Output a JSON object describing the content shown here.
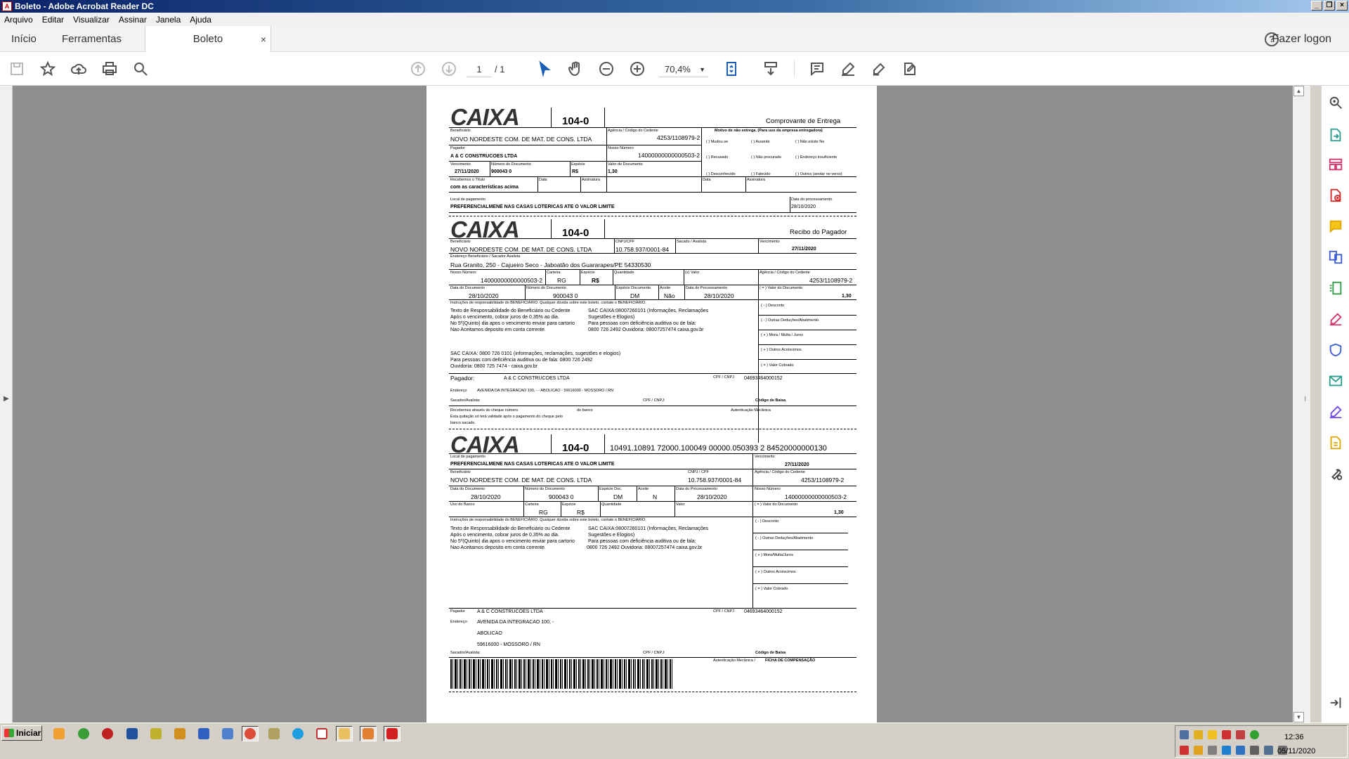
{
  "window": {
    "title": "Boleto - Adobe Acrobat Reader DC"
  },
  "menu": [
    "Arquivo",
    "Editar",
    "Visualizar",
    "Assinar",
    "Janela",
    "Ajuda"
  ],
  "tabs": {
    "home": "Início",
    "tools": "Ferramentas",
    "doc": "Boleto",
    "close": "×"
  },
  "header": {
    "help": "?",
    "login": "Fazer logon"
  },
  "toolbar": {
    "page_current": "1",
    "page_total": "/ 1",
    "zoom": "70,4%"
  },
  "taskbar": {
    "start": "Iniciar",
    "time": "12:36",
    "date": "05/11/2020"
  },
  "boleto": {
    "logo": "CAIXA",
    "bank_code": "104-0",
    "s1": {
      "title": "Comprovante de Entrega",
      "lbl_benef": "Beneficiário",
      "benef": "NOVO NORDESTE COM. DE MAT. DE CONS. LTDA",
      "lbl_agencia": "Agência / Código do Cedente",
      "agencia": "4253/1108979-2",
      "lbl_motivo": "Motivo de não entrega. (Para uso da empresa entregadora)",
      "m1": "(   ) Mudou-se",
      "m2": "(   ) Ausente",
      "m3": "(   ) Não existe No",
      "m4": "(   ) Recusado",
      "m5": "(   ) Não procurado",
      "m6": "(   ) Endereço insuficiente",
      "m7": "(   ) Desconhecido",
      "m8": "(   ) Falecido",
      "m9": "(   ) Outros (anotar no verso)",
      "lbl_pagador": "Pagador",
      "pagador": "A & C CONSTRUCOES LTDA",
      "lbl_nosso": "Nosso Número",
      "nosso": "14000000000000503-2",
      "lbl_venc": "Vencimento",
      "venc": "27/11/2020",
      "lbl_numdoc": "Número do Documento",
      "numdoc": "900043 0",
      "lbl_especie": "Espécie",
      "especie": "R$",
      "lbl_valor": "Valor do Documento",
      "valor": "1,30",
      "lbl_receb": "Recebemos o Título",
      "receb": "com as características acima",
      "lbl_data": "Data",
      "lbl_assin": "Assinatura",
      "lbl_local": "Local de pagamento",
      "local": "PREFERENCIALMENE NAS CASAS LOTERICAS ATE O VALOR LIMITE",
      "lbl_proc": "Data do processamento",
      "proc": "28/10/2020"
    },
    "s2": {
      "title": "Recibo do Pagador",
      "lbl_benef": "Beneficiário",
      "benef": "NOVO NORDESTE COM. DE MAT. DE CONS. LTDA",
      "lbl_cnpj": "CNPJ/CPF",
      "cnpj": "10.758.937/0001-84",
      "lbl_sacador": "Sacado / Avalista",
      "lbl_venc": "Vencimento",
      "venc": "27/11/2020",
      "lbl_end": "Endereço Beneficiário / Sacador Avalista",
      "end": "Rua Granito, 250  - Cajueiro Seco - Jaboatão dos Guararapes/PE 54330530",
      "lbl_nosso": "Nosso Número",
      "nosso": "14000000000000503-2",
      "lbl_carteira": "Carteira",
      "carteira": "RG",
      "lbl_especie": "Espécie",
      "especie": "R$",
      "lbl_qtd": "Quantidade",
      "lbl_xvalor": "(x) Valor",
      "lbl_agencia": "Agência / Código do Cedente",
      "agencia": "4253/1108979-2",
      "lbl_datadoc": "Data do Documento",
      "datadoc": "28/10/2020",
      "lbl_numdoc": "Número do Documento",
      "numdoc": "900043 0",
      "lbl_espdoc": "Espécie Documento",
      "espdoc": "DM",
      "lbl_aceite": "Aceite",
      "aceite": "Não",
      "lbl_dataproc": "Data do Processamento",
      "dataproc": "28/10/2020",
      "lbl_valordoc": "( = ) Valor do Documento",
      "valordoc": "1,30",
      "lbl_instr": "Instruções de responsabilidade do BENEFICIÁRIO. Qualquer dúvida sobre este boleto, contate o BENEFICIÁRIO.",
      "i1": "Texto de Responsabilidade do Beneficiário ou Cedente",
      "i2": "Após o vencimento, cobrar juros de 0,35% ao dia.",
      "i3": "No 5º(Quinto) dia apos o vencimento enviar para cartorio",
      "i4": "Nao Aceitamos deposito em conta corrente.",
      "j1": "SAC CAIXA:08007260101 (Informações, Reclamações",
      "j2": "Sugestões e Elogios)",
      "j3": "Para pessoas com deficiência auditiva ou de fala:",
      "j4": "0800 726 2492 Ouvidoria: 08007257474 caixa.gov.br",
      "k1": "SAC CAIXA: 0800 726 0101 (informações, reclamações, sugestões e elogios)",
      "k2": "Para pessoas com deficiência auditiva ou de fala: 0800 726 2492",
      "k3": "Ouvidoria: 0800 725 7474 - caixa.gov.br",
      "d1": "( - ) Desconto",
      "d2": "( - ) Outras Deduções/Abatimento",
      "d3": "( + ) Mora / Multa / Juros",
      "d4": "( + ) Outros Acréscimos",
      "d5": "( = ) Valor Cobrado",
      "lbl_pag": "Pagador:",
      "pag": "A & C CONSTRUCOES LTDA",
      "lbl_cpf": "CPF / CNPJ",
      "cpf": "04693464000152",
      "lbl_endereco": "Endereço",
      "endereco": "AVENIDA DA INTEGRACAO 100,  -  - ABOLICAO - 59616000 - MOSSORO / RN",
      "lbl_sac": "Sacador/Avalista:",
      "lbl_cpf2": "CPF / CNPJ:",
      "lbl_cod": "Código de Baixa",
      "r1": "Recebemos através do cheque número",
      "r2": "do banco",
      "r3": "Autenticação Mecânica",
      "r4": "Esta quitação só terá validade após o pagamento do cheque pelo",
      "r5": "banco sacado."
    },
    "s3": {
      "linha": "10491.10891 72000.100049 00000.050393 2 84520000000130",
      "lbl_local": "Local de pagamento",
      "local": "PREFERENCIALMENE NAS CASAS LOTERICAS ATE O VALOR LIMITE",
      "lbl_venc": "Vencimento",
      "venc": "27/11/2020",
      "lbl_benef": "Beneficiário",
      "benef": "NOVO NORDESTE COM. DE MAT. DE CONS. LTDA",
      "lbl_cnpj": "CNPJ / CPF",
      "cnpj": "10.758.937/0001-84",
      "lbl_agencia": "Agência / Código do Cedente",
      "agencia": "4253/1108979-2",
      "lbl_datadoc": "Data do Documento",
      "datadoc": "28/10/2020",
      "lbl_numdoc": "Número do Documento",
      "numdoc": "900043 0",
      "lbl_espdoc": "Espécie Doc.",
      "espdoc": "DM",
      "lbl_aceite": "Aceite",
      "aceite": "N",
      "lbl_dataproc": "Data do Processamento",
      "dataproc": "28/10/2020",
      "lbl_nosso": "Nosso Número",
      "nosso": "14000000000000503-2",
      "lbl_uso": "Uso do Banco",
      "lbl_carteira": "Carteira",
      "carteira": "RG",
      "lbl_especie": "Espécie",
      "especie": "R$",
      "lbl_qtd": "Quantidade",
      "lbl_valor": "Valor",
      "lbl_valordoc": "( = ) Valor do Documento",
      "valordoc": "1,30",
      "lbl_instr": "Instruções de responsabilidade do BENEFICIÁRIO. Qualquer dúvida sobre este boleto, contate o BENEFICIÁRIO.",
      "i1": "Texto de Responsabilidade do Beneficiário ou Cedente",
      "i2": "Após o vencimento, cobrar juros de 0,35% ao dia.",
      "i3": "No 5º(Quinto) dia apos o vencimento enviar para cartorio",
      "i4": "Nao Aceitamos deposito em conta corrente.",
      "j1": "SAC CAIXA:08007260101 (Informações, Reclamações",
      "j2": "Sugestões e Elogios)",
      "j3": "Para pessoas com deficiência auditiva ou de fala:",
      "j4": "0800 726 2492 Ouvidoria: 08007257474 caixa.gov.br",
      "d1": "( - ) Desconto",
      "d2": "( - ) Outras Deduções/Abatimento",
      "d3": "( + ) Mora/Multa/Juros",
      "d4": "( + ) Outros Acréscimos",
      "d5": "( = ) Valor Cobrado",
      "lbl_pag": "Pagador",
      "pag": "A & C CONSTRUCOES LTDA",
      "lbl_cpf": "CPF / CNPJ",
      "cpf": "04693464000152",
      "lbl_endereco": "Endereço:",
      "e1": "AVENIDA DA INTEGRACAO 100,  -",
      "e2": "ABOLICAO",
      "e3": "59616000 - MOSSORO / RN",
      "lbl_sac": "Sacador/Avalista:",
      "lbl_cpf2": "CPF / CNPJ:",
      "lbl_cod": "Código de Baixa",
      "lbl_aut": "Autenticação Mecânica /",
      "ficha": "FICHA DE COMPENSAÇÃO"
    }
  }
}
